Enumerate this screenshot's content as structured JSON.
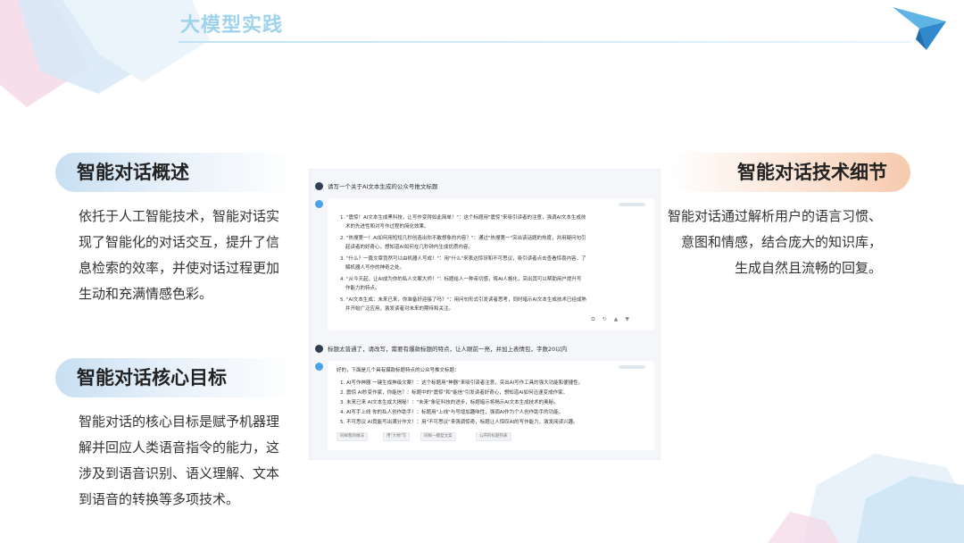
{
  "header": {
    "title": "大模型实践"
  },
  "sections": {
    "overview": {
      "heading": "智能对话概述",
      "lines": [
        "依托于人工智能技术，智能对话实",
        "现了智能化的对话交互，提升了信",
        "息检索的效率，并使对话过程更加",
        "生动和充满情感色彩。"
      ]
    },
    "goal": {
      "heading": "智能对话核心目标",
      "lines": [
        "智能对话的核心目标是赋予机器理",
        "解并回应人类语音指令的能力，这",
        "涉及到语音识别、语义理解、文本",
        "到语音的转换等多项技术。"
      ]
    },
    "tech": {
      "heading": "智能对话技术细节",
      "lines": [
        "智能对话通过解析用户的语言习惯、",
        "意图和情感，结合庞大的知识库，",
        "生成自然且流畅的回复。"
      ]
    }
  },
  "screenshot": {
    "q1": "请写一个关于AI文本生成的公众号推文标题",
    "q2": "标题太普通了，请改写，需要有爆款标题的特点，让人眼前一亮，并加上表情包，字数20以内",
    "a2_intro": "好的，下面是几个具有爆款标题特点的公众号推文标题：",
    "a1_items": [
      "1. \"震惊！AI文本生成黑科技，让写作变得如此简单！\"：这个标题用\"震惊\"来吸引读者的注意，强调AI文本生成技",
      "术的先进性和对写作过程的简化效果。",
      "2. \"热搜第一！AI如何用短短几秒创造出你不敢想象的内容？\"：通过\"热搜第一\"突出该话题的热度，并用疑问句引",
      "起读者的好奇心，想知道AI如何在几秒钟内生成优质内容。",
      "3. \"什么？一篇文章竟然可以由机器人写成！\"：用\"什么\"来表达惊讶和不可思议，吸引读者点击查看惊喜内容，了",
      "解机器人写作的神奇之处。",
      "4. \"从今天起，让AI成为你的私人文案大师！\"：标题给人一种亲切感，将AI人格化，突出其可以帮助用户提升写",
      "作能力的特点。",
      "5. \"AI文本生成：未来已来，你准备好迎接了吗？\"：用问句形式引发读者思考，同时暗示AI文本生成技术已经成熟",
      "并开始广泛应用，激发读者对未来的期待和关注。"
    ],
    "a2_items": [
      "1. AI写作神器 一键生成神级文案！：这个标题用\"神器\"来吸引读者注意，突出AI写作工具的强大功能和便捷性。",
      "2. 震惊 AI秒变作家，你能信？：标题中的\"震惊\"和\"能信\"引发读者好奇心，想知道AI如何迅速变成作家。",
      "3. 未来已来 AI文本生成大揭秘！：\"未来\"象征科技的进步，标题暗示将揭示AI文本生成技术的奥秘。",
      "4. AI写手上线 你的私人创作助手！：标题用\"上线\"与号增加趣味性，强调AI作为个人创作助手的功能。",
      "5. 不可思议 AI竟能写出满分作文！：用\"不可思议\"来强调惊奇，标题让人惊叹AI的写作能力，激发阅读兴趣。"
    ],
    "chips": [
      "同样我的做法",
      "用\"大纲\"写",
      "同样一模型文案",
      "公开的标题列表"
    ],
    "actions": [
      "复制",
      "重新生成",
      "赞",
      "踩"
    ]
  },
  "colors": {
    "title": "#9fd3ec",
    "left_pill": "#c7dff2",
    "right_pill": "#f6caad"
  }
}
